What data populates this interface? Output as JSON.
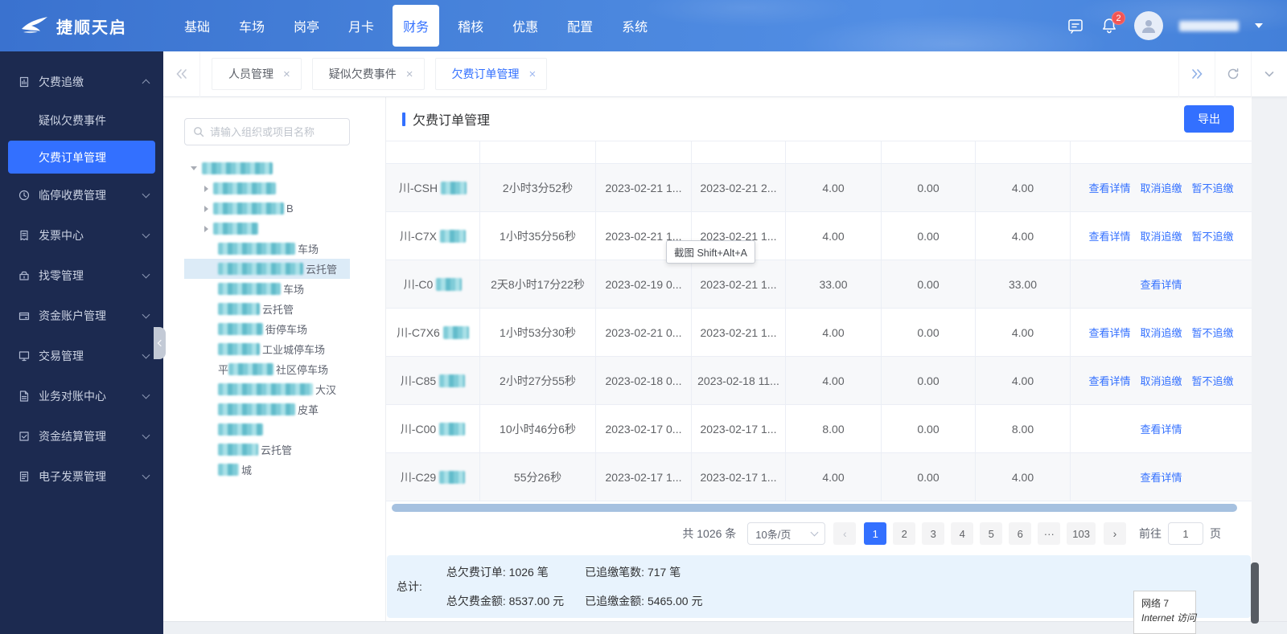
{
  "header": {
    "brand": "捷顺天启",
    "nav_items": [
      "基础",
      "车场",
      "岗亭",
      "月卡",
      "财务",
      "稽核",
      "优惠",
      "配置",
      "系统"
    ],
    "active_nav_index": 4,
    "notification_badge": "2"
  },
  "sidebar": {
    "items": [
      {
        "label": "欠费追缴",
        "type": "group",
        "expanded": true,
        "icon": "arrears-icon"
      },
      {
        "label": "疑似欠费事件",
        "type": "sub",
        "active": false
      },
      {
        "label": "欠费订单管理",
        "type": "sub",
        "active": true
      },
      {
        "label": "临停收费管理",
        "type": "group",
        "expanded": false,
        "icon": "temp-fee-icon"
      },
      {
        "label": "发票中心",
        "type": "group",
        "expanded": false,
        "icon": "invoice-icon"
      },
      {
        "label": "找零管理",
        "type": "group",
        "expanded": false,
        "icon": "change-icon"
      },
      {
        "label": "资金账户管理",
        "type": "group",
        "expanded": false,
        "icon": "fund-account-icon"
      },
      {
        "label": "交易管理",
        "type": "group",
        "expanded": false,
        "icon": "trade-icon"
      },
      {
        "label": "业务对账中心",
        "type": "group",
        "expanded": false,
        "icon": "reconcile-icon"
      },
      {
        "label": "资金结算管理",
        "type": "group",
        "expanded": false,
        "icon": "settlement-icon"
      },
      {
        "label": "电子发票管理",
        "type": "group",
        "expanded": false,
        "icon": "einvoice-icon"
      }
    ]
  },
  "tabs": {
    "items": [
      {
        "label": "人员管理",
        "active": false
      },
      {
        "label": "疑似欠费事件",
        "active": false
      },
      {
        "label": "欠费订单管理",
        "active": true
      }
    ]
  },
  "tree": {
    "search_placeholder": "请输入组织或项目名称",
    "items": [
      {
        "level": 0,
        "caret": "expanded",
        "redacted_width": 88,
        "prefix": "",
        "text": "",
        "selected": false
      },
      {
        "level": 1,
        "caret": "collapsed",
        "redacted_width": 78,
        "prefix": "",
        "text": "",
        "selected": false
      },
      {
        "level": 1,
        "caret": "collapsed",
        "redacted_width": 88,
        "prefix": "",
        "text": "B",
        "selected": false
      },
      {
        "level": 1,
        "caret": "collapsed",
        "redacted_width": 56,
        "prefix": "",
        "text": "",
        "selected": false
      },
      {
        "level": 2,
        "caret": "",
        "redacted_width": 96,
        "prefix": "",
        "text": "车场",
        "selected": false
      },
      {
        "level": 2,
        "caret": "",
        "redacted_width": 106,
        "prefix": "",
        "text": "云托管",
        "selected": true
      },
      {
        "level": 2,
        "caret": "",
        "redacted_width": 78,
        "prefix": "",
        "text": "车场",
        "selected": false
      },
      {
        "level": 2,
        "caret": "",
        "redacted_width": 52,
        "prefix": "",
        "text": "云托管",
        "selected": false
      },
      {
        "level": 2,
        "caret": "",
        "redacted_width": 56,
        "prefix": "",
        "text": "街停车场",
        "selected": false
      },
      {
        "level": 2,
        "caret": "",
        "redacted_width": 52,
        "prefix": "",
        "text": "工业城停车场",
        "selected": false
      },
      {
        "level": 2,
        "caret": "",
        "redacted_width": 56,
        "prefix": "平",
        "text": "社区停车场",
        "selected": false
      },
      {
        "level": 2,
        "caret": "",
        "redacted_width": 118,
        "prefix": "",
        "text": "大汉",
        "selected": false
      },
      {
        "level": 2,
        "caret": "",
        "redacted_width": 96,
        "prefix": "",
        "text": "皮革",
        "selected": false
      },
      {
        "level": 2,
        "caret": "",
        "redacted_width": 56,
        "prefix": "",
        "text": "",
        "selected": false
      },
      {
        "level": 2,
        "caret": "",
        "redacted_width": 50,
        "prefix": "",
        "text": "云托管",
        "selected": false
      },
      {
        "level": 2,
        "caret": "",
        "redacted_width": 26,
        "prefix": "",
        "text": "城",
        "selected": false
      }
    ]
  },
  "main": {
    "title": "欠费订单管理",
    "export_button": "导出",
    "table": {
      "rows": [
        {
          "plate_prefix": "川-CSH",
          "duration": "2小时3分52秒",
          "start": "2023-02-21 1...",
          "end": "2023-02-21 2...",
          "amount1": "4.00",
          "amount2": "0.00",
          "amount3": "4.00",
          "actions": [
            "查看详情",
            "取消追缴",
            "暂不追缴"
          ]
        },
        {
          "plate_prefix": "川-C7X",
          "duration": "1小时35分56秒",
          "start": "2023-02-21 1...",
          "end": "2023-02-21 1...",
          "amount1": "4.00",
          "amount2": "0.00",
          "amount3": "4.00",
          "actions": [
            "查看详情",
            "取消追缴",
            "暂不追缴"
          ]
        },
        {
          "plate_prefix": "川-C0",
          "duration": "2天8小时17分22秒",
          "start": "2023-02-19 0...",
          "end": "2023-02-21 1...",
          "amount1": "33.00",
          "amount2": "0.00",
          "amount3": "33.00",
          "actions": [
            "查看详情"
          ]
        },
        {
          "plate_prefix": "川-C7X6",
          "duration": "1小时53分30秒",
          "start": "2023-02-21 0...",
          "end": "2023-02-21 1...",
          "amount1": "4.00",
          "amount2": "0.00",
          "amount3": "4.00",
          "actions": [
            "查看详情",
            "取消追缴",
            "暂不追缴"
          ]
        },
        {
          "plate_prefix": "川-C85",
          "duration": "2小时27分55秒",
          "start": "2023-02-18 0...",
          "end": "2023-02-18 11...",
          "amount1": "4.00",
          "amount2": "0.00",
          "amount3": "4.00",
          "actions": [
            "查看详情",
            "取消追缴",
            "暂不追缴"
          ]
        },
        {
          "plate_prefix": "川-C00",
          "duration": "10小时46分6秒",
          "start": "2023-02-17 0...",
          "end": "2023-02-17 1...",
          "amount1": "8.00",
          "amount2": "0.00",
          "amount3": "8.00",
          "actions": [
            "查看详情"
          ]
        },
        {
          "plate_prefix": "川-C29",
          "duration": "55分26秒",
          "start": "2023-02-17 1...",
          "end": "2023-02-17 1...",
          "amount1": "4.00",
          "amount2": "0.00",
          "amount3": "4.00",
          "actions": [
            "查看详情"
          ]
        }
      ]
    },
    "pagination": {
      "total_text": "共 1026 条",
      "page_size": "10条/页",
      "pages": [
        "1",
        "2",
        "3",
        "4",
        "5",
        "6",
        "...",
        "103"
      ],
      "active_page": "1",
      "goto_label": "前往",
      "goto_value": "1",
      "goto_suffix": "页"
    },
    "summary": {
      "label": "总计:",
      "items": [
        "总欠费订单: 1026 笔",
        "已追缴笔数: 717 笔",
        "总欠费金额: 8537.00 元",
        "已追缴金额: 5465.00 元"
      ]
    }
  },
  "overlays": {
    "screenshot_tooltip": "截图 Shift+Alt+A",
    "network_popup_line1": "网络 7",
    "network_popup_line2": "Internet 访问"
  },
  "colors": {
    "accent": "#3370ff",
    "header_blue": "#4a86dd",
    "sidebar_navy": "#1c2a50",
    "badge_red": "#f25555"
  }
}
